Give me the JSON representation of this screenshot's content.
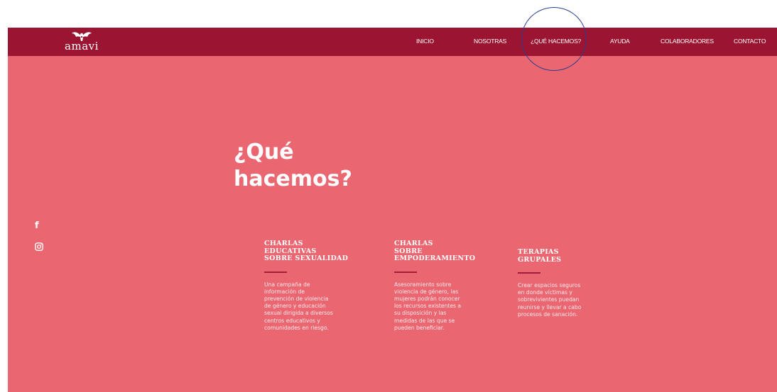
{
  "brand": {
    "name": "amavi"
  },
  "nav": {
    "items": [
      {
        "label": "INICIO"
      },
      {
        "label": "NOSOTRAS"
      },
      {
        "label": "¿QUÉ HACEMOS?"
      },
      {
        "label": "AYUDA"
      },
      {
        "label": "COLABORADORES"
      },
      {
        "label": "CONTACTO"
      }
    ],
    "active_index": 2
  },
  "hero": {
    "title": "¿Qué\nhacemos?"
  },
  "social": {
    "icons": [
      "facebook-icon",
      "instagram-icon"
    ]
  },
  "cards": [
    {
      "title": "CHARLAS\nEDUCATIVAS\nSOBRE SEXUALIDAD",
      "body": "Una campaña de\ninformación de\nprevención de violencia\nde género y educación\nsexual dirigida a diversos\ncentros educativos y\ncomunidades en riesgo."
    },
    {
      "title": "CHARLAS\nSOBRE\nEMPODERAMIENTO",
      "body": "Asesoramiento sobre\nviolencia de género, las\nmujeres podrán conocer\nlos recursos existentes a\nsu disposición y las\nmedidas de las que se\npueden beneficiar."
    },
    {
      "title": "TERAPIAS\nGRUPALES",
      "body": "Crear espacios seguros\nen donde víctimas y\nsobrevivientes puedan\nreunirse y llevar a cabo\nprocesos de sanación."
    }
  ],
  "colors": {
    "navbar": "#9b1532",
    "background": "#ea6671",
    "accent_rule": "#a31c3a",
    "annotation_circle": "#2b3f8f"
  }
}
